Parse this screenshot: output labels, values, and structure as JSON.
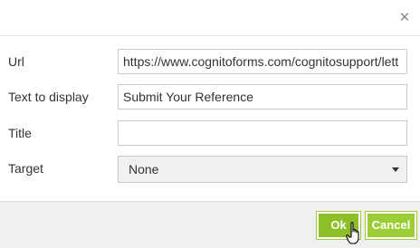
{
  "dialog": {
    "close_icon": "close-icon"
  },
  "form": {
    "url_label": "Url",
    "url_value": "https://www.cognitoforms.com/cognitosupport/lett",
    "text_label": "Text to display",
    "text_value": "Submit Your Reference",
    "title_label": "Title",
    "title_value": "",
    "target_label": "Target",
    "target_value": "None"
  },
  "footer": {
    "ok_label": "Ok",
    "cancel_label": "Cancel"
  },
  "colors": {
    "ok": "#8dc028",
    "cancel": "#9ccd36",
    "footer_bg": "#f0f0f0"
  }
}
